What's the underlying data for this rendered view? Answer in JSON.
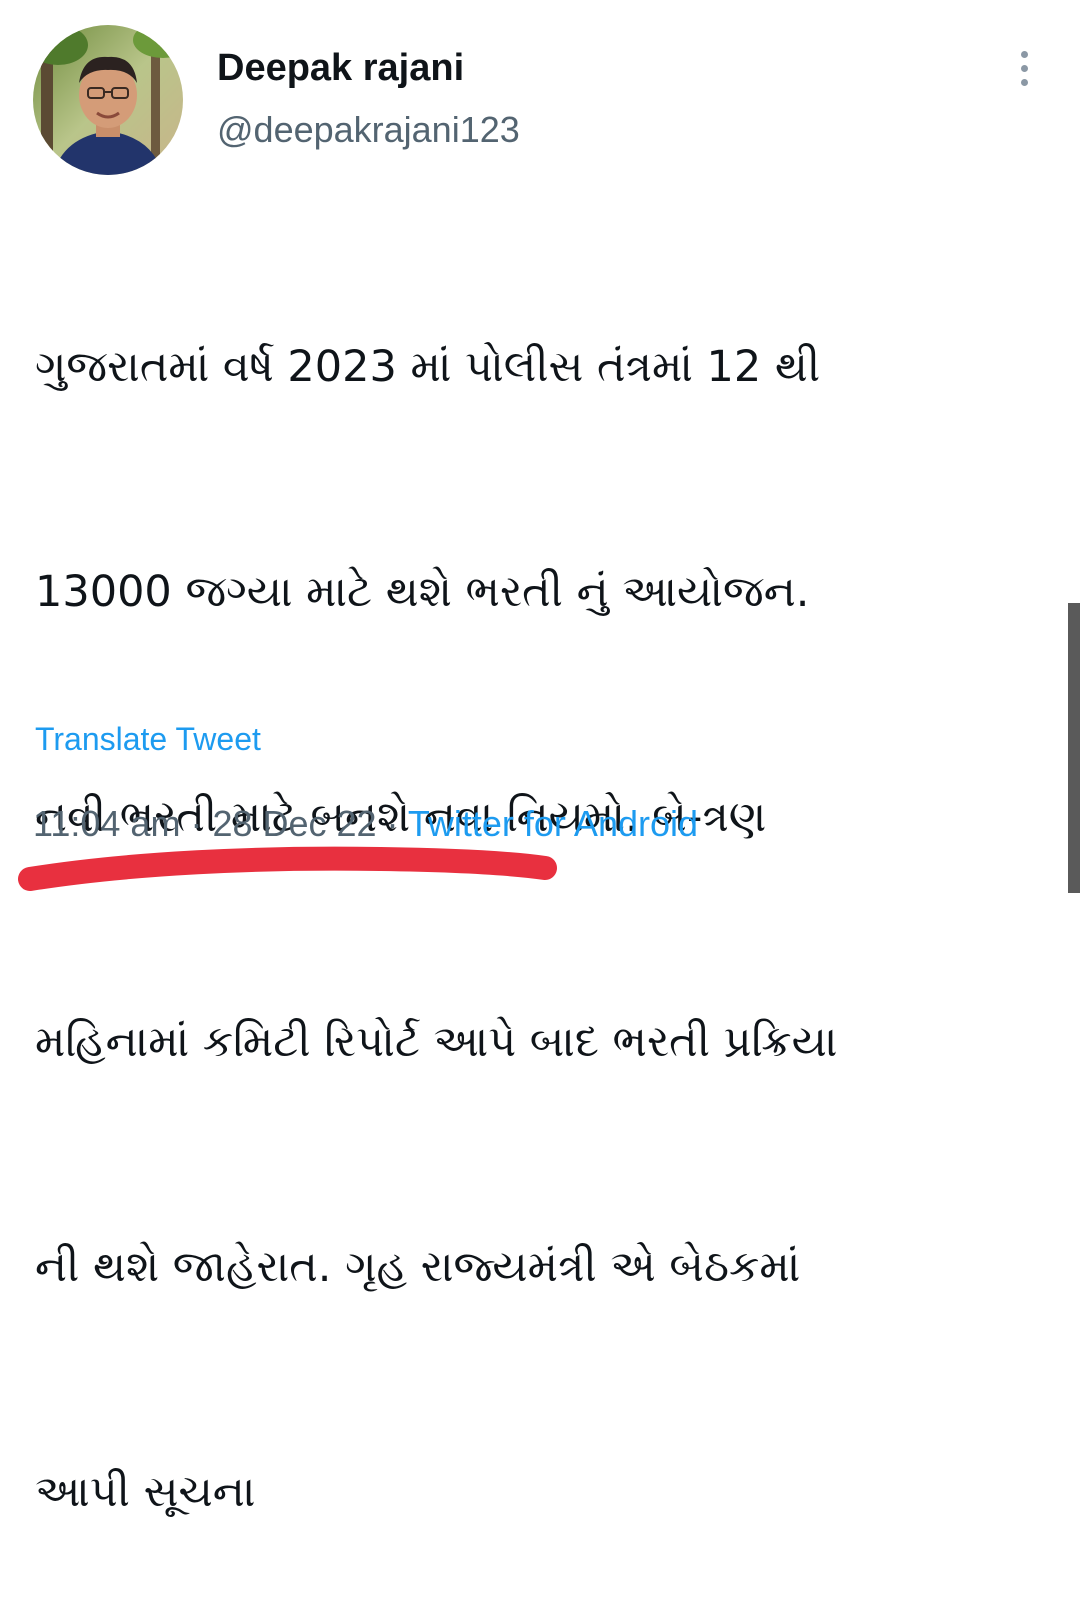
{
  "tweet": {
    "display_name": "Deepak rajani",
    "handle": "@deepakrajani123",
    "text_lines": [
      "ગુજરાતમાં વર્ષ 2023 માં પોલીસ તંત્રમાં 12 થી",
      "13000 જગ્યા માટે થશે ભરતી નું આયોજન.",
      "નવી ભરતી માટે બનશે નવા નિયમો. બે-ત્રણ",
      "મહિનામાં કમિટી રિપોર્ટ આપે બાદ ભરતી પ્રક્રિયા",
      "ની થશે જાહેરાત. ગૃહ રાજ્યમંત્રી એ બેઠકમાં",
      "આપી સૂચના"
    ],
    "translate_label": "Translate Tweet",
    "time": "11:04 am",
    "separator": " · ",
    "date": "28 Dec 22",
    "source": "Twitter for Android"
  },
  "icons": {
    "more": "more-vertical-icon"
  },
  "colors": {
    "text": "#0f1419",
    "secondary": "#536471",
    "link": "#1d9bf0",
    "annotation": "#e8303f"
  }
}
